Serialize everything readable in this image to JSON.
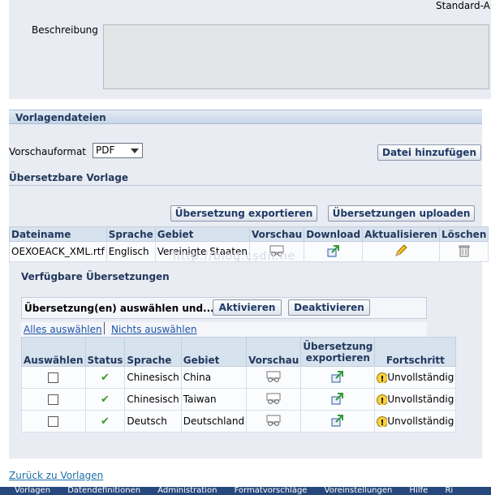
{
  "top_right_text": "Standard-A",
  "description": {
    "label": "Beschreibung",
    "value": ""
  },
  "section_title": "Vorlagendateien",
  "preview_format": {
    "label": "Vorschauformat",
    "selected": "PDF"
  },
  "add_file_button": "Datei hinzufügen",
  "translatable_title": "Übersetzbare Vorlage",
  "export_translation_button": "Übersetzung exportieren",
  "upload_translations_button": "Übersetzungen uploaden",
  "template_table": {
    "headers": [
      "Dateiname",
      "Sprache",
      "Gebiet",
      "Vorschau",
      "Download",
      "Aktualisieren",
      "Löschen"
    ],
    "rows": [
      {
        "file": "OEXOEACK_XML.rtf",
        "language": "Englisch",
        "territory": "Vereinigte Staaten"
      }
    ]
  },
  "watermark": "http://blog.csdn.ne",
  "available_title": "Verfügbare Übersetzungen",
  "select_bar": {
    "label": "Übersetzung(en) auswählen und...",
    "activate": "Aktivieren",
    "deactivate": "Deaktivieren"
  },
  "select_all": "Alles auswählen",
  "select_none": "Nichts auswählen",
  "translations_table": {
    "headers": [
      "Auswählen",
      "Status",
      "Sprache",
      "Gebiet",
      "Vorschau",
      "Übersetzung exportieren",
      "Fortschritt"
    ],
    "rows": [
      {
        "language": "Chinesisch",
        "territory": "China",
        "progress": "Unvollständig"
      },
      {
        "language": "Chinesisch",
        "territory": "Taiwan",
        "progress": "Unvollständig"
      },
      {
        "language": "Deutsch",
        "territory": "Deutschland",
        "progress": "Unvollständig"
      }
    ]
  },
  "back_link": "Zurück zu Vorlagen",
  "footer_links": [
    "Vorlagen",
    "Datendefinitionen",
    "Administration",
    "Formatvorschläge",
    "Voreinstellungen",
    "Hilfe",
    "Ri"
  ],
  "colors": {
    "accent": "#26487c",
    "panel": "#e9ecf2",
    "link": "#1d53a8"
  }
}
